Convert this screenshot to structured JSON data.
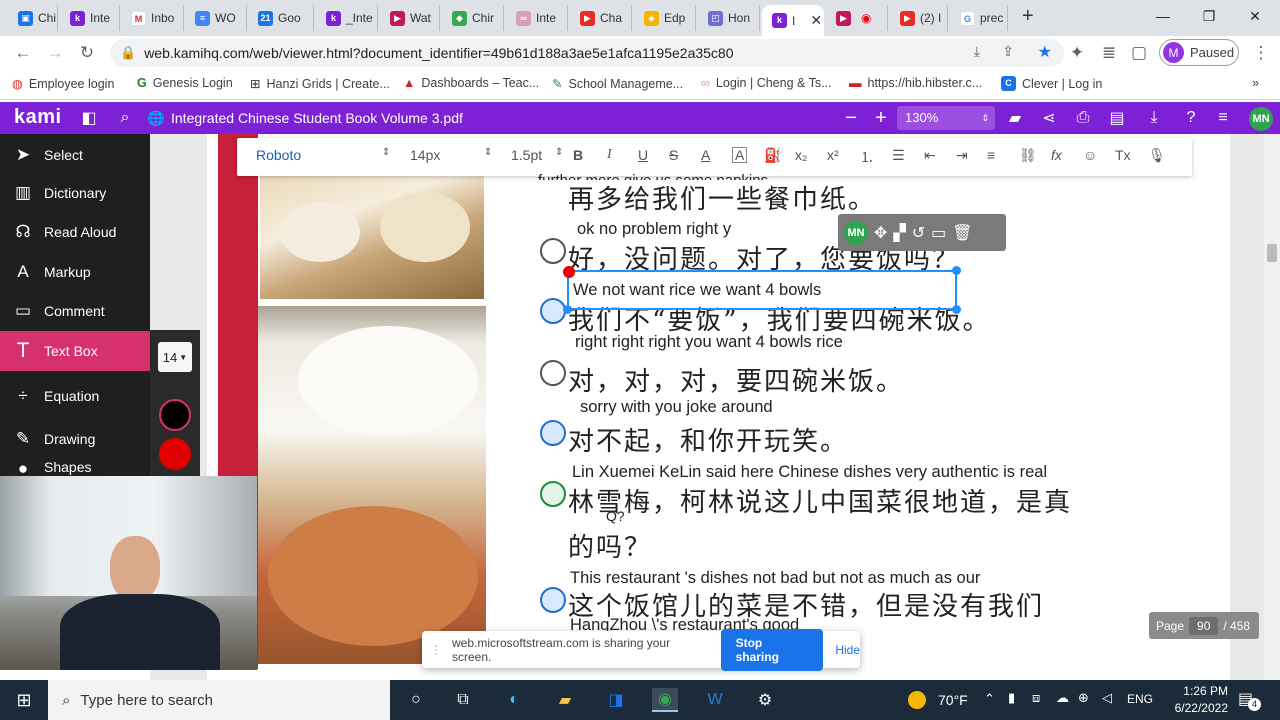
{
  "browser": {
    "tabs": [
      {
        "label": "Chi",
        "color": "#1a73e8",
        "glyph": "▣"
      },
      {
        "label": "Inte",
        "color": "#7c21d6",
        "glyph": "k"
      },
      {
        "label": "Inbo",
        "color": "#d93025",
        "glyph": "M"
      },
      {
        "label": "WO",
        "color": "#4285f4",
        "glyph": "≡"
      },
      {
        "label": "Goo",
        "color": "#1a73e8",
        "glyph": "21"
      },
      {
        "label": "_Inte",
        "color": "#7c21d6",
        "glyph": "k"
      },
      {
        "label": "Wat",
        "color": "#c2185b",
        "glyph": "▶"
      },
      {
        "label": "Chir",
        "color": "#34a853",
        "glyph": "◆"
      },
      {
        "label": "Inte",
        "color": "#d7a0b5",
        "glyph": "∞"
      },
      {
        "label": "Cha",
        "color": "#e52d27",
        "glyph": "▶"
      },
      {
        "label": "Edp",
        "color": "#f4b400",
        "glyph": "◈"
      },
      {
        "label": "Hon",
        "color": "#6f6fd0",
        "glyph": "◰"
      },
      {
        "label": "I",
        "color": "#7c21d6",
        "glyph": "k"
      },
      {
        "label": "",
        "color": "#c2185b",
        "glyph": "▶"
      },
      {
        "label": "(2) I",
        "color": "#e52d27",
        "glyph": "▶"
      },
      {
        "label": "prec",
        "color": "#4285f4",
        "glyph": "G"
      }
    ],
    "url": "web.kamihq.com/web/viewer.html?document_identifier=49b61d188a3ae5e1afca1195e2a35c80",
    "profile_initial": "M",
    "profile_status": "Paused",
    "bookmarks": [
      "Employee login",
      "Genesis Login",
      "Hanzi Grids | Create...",
      "Dashboards – Teac...",
      "School Manageme...",
      "Login | Cheng & Ts...",
      "https://hib.hibster.c...",
      "Clever | Log in"
    ]
  },
  "kami": {
    "logo": "kami",
    "doc_title": "Integrated Chinese Student Book Volume 3.pdf",
    "zoom": "130%",
    "user_initials": "MN",
    "tools": [
      "Select",
      "Dictionary",
      "Read Aloud",
      "Markup",
      "Comment",
      "Text Box",
      "Equation",
      "Drawing",
      "Shapes"
    ],
    "text_size": "14",
    "swatch_colors": [
      "#000000",
      "#e00000"
    ],
    "format": {
      "font": "Roboto",
      "size": "14px",
      "spacing": "1.5pt"
    },
    "page_label": "Page",
    "page_current": "90",
    "page_total": "/ 458"
  },
  "document": {
    "lines": [
      {
        "en": "further more give us some napkins",
        "cn": "再多给我们一些餐巾纸。"
      },
      {
        "en": "ok      no problem      right          y",
        "cn": "好，没问题。对了，您要饭吗？"
      },
      {
        "en": "We      not want rice          we    want 4 bowls",
        "cn": "我们不“要饭”，我们要四碗米饭。"
      },
      {
        "en": "right     right     right you want 4 bowls rice",
        "cn": "对，对，对，要四碗米饭。"
      },
      {
        "en": "sorry                with you joke around",
        "cn": "对不起，和你开玩笑。"
      },
      {
        "en": "Lin Xuemei       KeLin  said here  Chinese dishes very authentic is real",
        "cn": "林雪梅，柯林说这儿中国菜很地道，是真"
      },
      {
        "en": "Q?",
        "cn": "的吗？"
      },
      {
        "en": "This      restaurant 's      dishes not bad        but       not as much as our",
        "cn": "这个饭馆儿的菜是不错，但是没有我们"
      },
      {
        "en": "HangZhou \\'s restaurant's good",
        "cn": ""
      }
    ]
  },
  "share": {
    "message": "web.microsoftstream.com is sharing your screen.",
    "stop": "Stop sharing",
    "hide": "Hide"
  },
  "taskbar": {
    "search_placeholder": "Type here to search",
    "weather": "70°F",
    "language": "ENG",
    "time": "1:26 PM",
    "date": "6/22/2022",
    "notifications": "4"
  }
}
